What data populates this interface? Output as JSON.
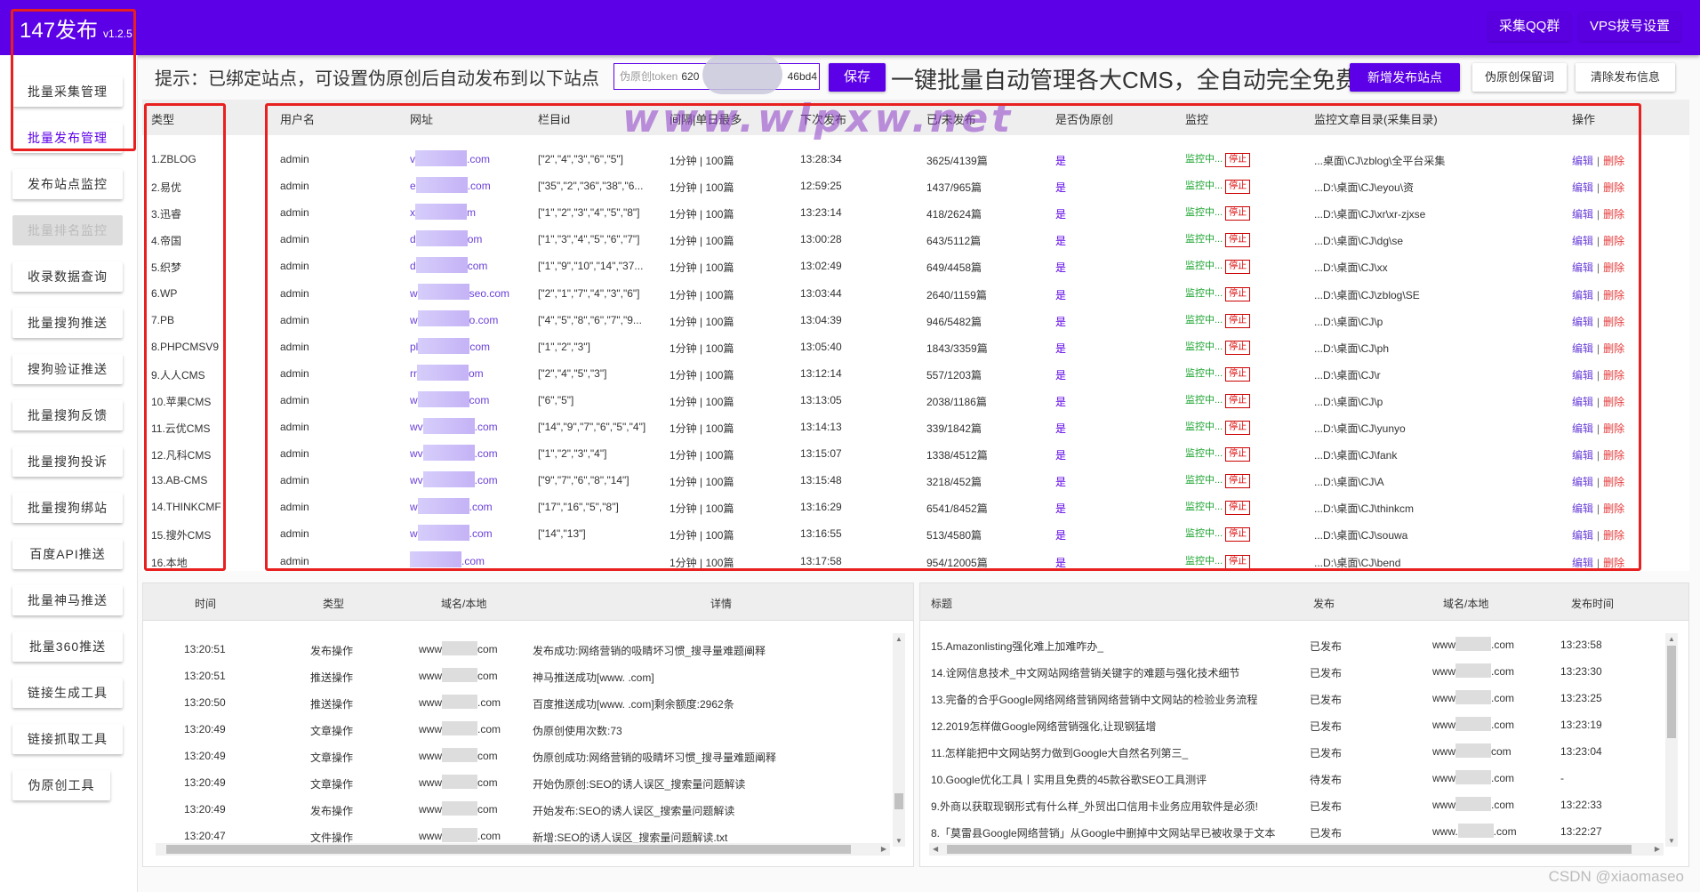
{
  "app": {
    "title": "147发布",
    "version": "v1.2.5"
  },
  "topbar": {
    "qq_group": "采集QQ群",
    "vps_settings": "VPS拨号设置"
  },
  "sidebar": {
    "items": [
      {
        "label": "批量采集管理",
        "state": "normal"
      },
      {
        "label": "批量发布管理",
        "state": "active"
      },
      {
        "label": "发布站点监控",
        "state": "normal"
      },
      {
        "label": "批量排名监控",
        "state": "disabled"
      },
      {
        "label": "收录数据查询",
        "state": "normal"
      },
      {
        "label": "批量搜狗推送",
        "state": "normal"
      },
      {
        "label": "搜狗验证推送",
        "state": "normal"
      },
      {
        "label": "批量搜狗反馈",
        "state": "normal"
      },
      {
        "label": "批量搜狗投诉",
        "state": "normal"
      },
      {
        "label": "批量搜狗绑站",
        "state": "normal"
      },
      {
        "label": "百度API推送",
        "state": "normal"
      },
      {
        "label": "批量神马推送",
        "state": "normal"
      },
      {
        "label": "批量360推送",
        "state": "normal"
      },
      {
        "label": "链接生成工具",
        "state": "normal"
      },
      {
        "label": "链接抓取工具",
        "state": "normal"
      },
      {
        "label": "伪原创工具",
        "state": "normal"
      }
    ]
  },
  "toolbar": {
    "hint": "提示：已绑定站点，可设置伪原创后自动发布到以下站点",
    "token_label": "伪原创token",
    "token_prefix": "620",
    "token_suffix": "46bd4",
    "save": "保存",
    "slogan": "一键批量自动管理各大CMS，全自动完全免费",
    "add_site": "新增发布站点",
    "keep_words": "伪原创保留词",
    "clear_info": "清除发布信息"
  },
  "watermark": "www.wlpxw.net",
  "sites_table": {
    "headers": {
      "type": "类型",
      "username": "用户名",
      "url": "网址",
      "column_id": "栏目id",
      "interval": "间隔|单日最多",
      "next_publish": "下次发布",
      "published": "已/未发布",
      "pseudo": "是否伪原创",
      "monitor": "监控",
      "monitor_dir": "监控文章目录(采集目录)",
      "actions": "操作"
    },
    "monitoring_label": "监控中...",
    "stop_label": "停止",
    "edit_label": "编辑",
    "delete_label": "删除",
    "rows": [
      {
        "type": "1.ZBLOG",
        "username": "admin",
        "url_pre": "v",
        "url_post": ".com",
        "column_id": "[\"2\",\"4\",\"3\",\"6\",\"5\"]",
        "interval": "1分钟 | 100篇",
        "next": "13:28:34",
        "published": "3625/4139篇",
        "pseudo": "是",
        "dir": "...桌面\\CJ\\zblog\\全平台采集"
      },
      {
        "type": "2.易优",
        "username": "admin",
        "url_pre": "e",
        "url_post": ".com",
        "column_id": "[\"35\",\"2\",\"36\",\"38\",\"6...",
        "interval": "1分钟 | 100篇",
        "next": "12:59:25",
        "published": "1437/965篇",
        "pseudo": "是",
        "dir": "...D:\\桌面\\CJ\\eyou\\资"
      },
      {
        "type": "3.迅睿",
        "username": "admin",
        "url_pre": "x",
        "url_post": "m",
        "column_id": "[\"1\",\"2\",\"3\",\"4\",\"5\",\"8\"]",
        "interval": "1分钟 | 100篇",
        "next": "13:23:14",
        "published": "418/2624篇",
        "pseudo": "是",
        "dir": "...D:\\桌面\\CJ\\xr\\xr-zjxse"
      },
      {
        "type": "4.帝国",
        "username": "admin",
        "url_pre": "d",
        "url_post": "om",
        "column_id": "[\"1\",\"3\",\"4\",\"5\",\"6\",\"7\"]",
        "interval": "1分钟 | 100篇",
        "next": "13:00:28",
        "published": "643/5112篇",
        "pseudo": "是",
        "dir": "...D:\\桌面\\CJ\\dg\\se"
      },
      {
        "type": "5.织梦",
        "username": "admin",
        "url_pre": "d",
        "url_post": "com",
        "column_id": "[\"1\",\"9\",\"10\",\"14\",\"37...",
        "interval": "1分钟 | 100篇",
        "next": "13:02:49",
        "published": "649/4458篇",
        "pseudo": "是",
        "dir": "...D:\\桌面\\CJ\\xx"
      },
      {
        "type": "6.WP",
        "username": "admin",
        "url_pre": "w",
        "url_post": "seo.com",
        "column_id": "[\"2\",\"1\",\"7\",\"4\",\"3\",\"6\"]",
        "interval": "1分钟 | 100篇",
        "next": "13:03:44",
        "published": "2640/1159篇",
        "pseudo": "是",
        "dir": "...D:\\桌面\\CJ\\zblog\\SE"
      },
      {
        "type": "7.PB",
        "username": "admin",
        "url_pre": "w",
        "url_post": "o.com",
        "column_id": "[\"4\",\"5\",\"8\",\"6\",\"7\",\"9...",
        "interval": "1分钟 | 100篇",
        "next": "13:04:39",
        "published": "946/5482篇",
        "pseudo": "是",
        "dir": "...D:\\桌面\\CJ\\p"
      },
      {
        "type": "8.PHPCMSV9",
        "username": "admin",
        "url_pre": "pl",
        "url_post": "com",
        "column_id": "[\"1\",\"2\",\"3\"]",
        "interval": "1分钟 | 100篇",
        "next": "13:05:40",
        "published": "1843/3359篇",
        "pseudo": "是",
        "dir": "...D:\\桌面\\CJ\\ph"
      },
      {
        "type": "9.人人CMS",
        "username": "admin",
        "url_pre": "rr",
        "url_post": "om",
        "column_id": "[\"2\",\"4\",\"5\",\"3\"]",
        "interval": "1分钟 | 100篇",
        "next": "13:12:14",
        "published": "557/1203篇",
        "pseudo": "是",
        "dir": "...D:\\桌面\\CJ\\r"
      },
      {
        "type": "10.苹果CMS",
        "username": "admin",
        "url_pre": "w",
        "url_post": "com",
        "column_id": "[\"6\",\"5\"]",
        "interval": "1分钟 | 100篇",
        "next": "13:13:05",
        "published": "2038/1186篇",
        "pseudo": "是",
        "dir": "...D:\\桌面\\CJ\\p"
      },
      {
        "type": "11.云优CMS",
        "username": "admin",
        "url_pre": "wv",
        "url_post": ".com",
        "column_id": "[\"14\",\"9\",\"7\",\"6\",\"5\",\"4\"]",
        "interval": "1分钟 | 100篇",
        "next": "13:14:13",
        "published": "339/1842篇",
        "pseudo": "是",
        "dir": "...D:\\桌面\\CJ\\yunyo"
      },
      {
        "type": "12.凡科CMS",
        "username": "admin",
        "url_pre": "wv",
        "url_post": ".com",
        "column_id": "[\"1\",\"2\",\"3\",\"4\"]",
        "interval": "1分钟 | 100篇",
        "next": "13:15:07",
        "published": "1338/4512篇",
        "pseudo": "是",
        "dir": "...D:\\桌面\\CJ\\fank"
      },
      {
        "type": "13.AB-CMS",
        "username": "admin",
        "url_pre": "wv",
        "url_post": ".com",
        "column_id": "[\"9\",\"7\",\"6\",\"8\",\"14\"]",
        "interval": "1分钟 | 100篇",
        "next": "13:15:48",
        "published": "3218/452篇",
        "pseudo": "是",
        "dir": "...D:\\桌面\\CJ\\A"
      },
      {
        "type": "14.THINKCMF",
        "username": "admin",
        "url_pre": "w",
        "url_post": ".com",
        "column_id": "[\"17\",\"16\",\"5\",\"8\"]",
        "interval": "1分钟 | 100篇",
        "next": "13:16:29",
        "published": "6541/8452篇",
        "pseudo": "是",
        "dir": "...D:\\桌面\\CJ\\thinkcm"
      },
      {
        "type": "15.搜外CMS",
        "username": "admin",
        "url_pre": "w",
        "url_post": ".com",
        "column_id": "[\"14\",\"13\"]",
        "interval": "1分钟 | 100篇",
        "next": "13:16:55",
        "published": "513/4580篇",
        "pseudo": "是",
        "dir": "...D:\\桌面\\CJ\\souwa"
      },
      {
        "type": "16.本地",
        "username": "admin",
        "url_pre": "",
        "url_post": ".com",
        "column_id": "",
        "interval": "1分钟 | 100篇",
        "next": "13:17:58",
        "published": "954/12005篇",
        "pseudo": "是",
        "dir": "...D:\\桌面\\CJ\\bend"
      }
    ]
  },
  "op_log": {
    "headers": {
      "time": "时间",
      "type": "类型",
      "domain": "域名/本地",
      "detail": "详情"
    },
    "rows": [
      {
        "time": "13:20:51",
        "type": "发布操作",
        "domain_pre": "www",
        "domain_post": "com",
        "detail": "发布成功:网络营销的吸睛坏习惯_搜寻量难题阐释"
      },
      {
        "time": "13:20:51",
        "type": "推送操作",
        "domain_pre": "www",
        "domain_post": "com",
        "detail": "神马推送成功[www.        .com]"
      },
      {
        "time": "13:20:50",
        "type": "推送操作",
        "domain_pre": "www",
        "domain_post": ".com",
        "detail": "百度推送成功[www.        .com]剩余额度:2962条"
      },
      {
        "time": "13:20:49",
        "type": "文章操作",
        "domain_pre": "www",
        "domain_post": ".com",
        "detail": "伪原创使用次数:73"
      },
      {
        "time": "13:20:49",
        "type": "文章操作",
        "domain_pre": "www",
        "domain_post": "com",
        "detail": "伪原创成功:网络营销的吸睛坏习惯_搜寻量难题阐释"
      },
      {
        "time": "13:20:49",
        "type": "文章操作",
        "domain_pre": "www",
        "domain_post": "com",
        "detail": "开始伪原创:SEO的诱人误区_搜索量问题解读"
      },
      {
        "time": "13:20:49",
        "type": "发布操作",
        "domain_pre": "www",
        "domain_post": "com",
        "detail": "开始发布:SEO的诱人误区_搜索量问题解读"
      },
      {
        "time": "13:20:47",
        "type": "文件操作",
        "domain_pre": "www",
        "domain_post": ".com",
        "detail": "新增:SEO的诱人误区_搜索量问题解读.txt"
      }
    ]
  },
  "publish_log": {
    "headers": {
      "title": "标题",
      "status": "发布",
      "domain": "域名/本地",
      "time": "发布时间"
    },
    "rows": [
      {
        "title": "15.Amazonlisting强化难上加难咋办_",
        "status": "已发布",
        "domain_pre": "www",
        "domain_post": ".com",
        "time": "13:23:58"
      },
      {
        "title": "14.诠网信息技术_中文网站网络营销关键字的难题与强化技术细节",
        "status": "已发布",
        "domain_pre": "www",
        "domain_post": ".com",
        "time": "13:23:30"
      },
      {
        "title": "13.完备的合乎Google网络网络营销网络营销中文网站的检验业务流程",
        "status": "已发布",
        "domain_pre": "www",
        "domain_post": ".com",
        "time": "13:23:25"
      },
      {
        "title": "12.2019怎样做Google网络营销强化,让现钢猛增",
        "status": "已发布",
        "domain_pre": "www",
        "domain_post": ".com",
        "time": "13:23:19"
      },
      {
        "title": "11.怎样能把中文网站努力做到Google大自然名列第三_",
        "status": "已发布",
        "domain_pre": "www",
        "domain_post": "com",
        "time": "13:23:04"
      },
      {
        "title": "10.Google优化工具丨实用且免费的45款谷歌SEO工具测评",
        "status": "待发布",
        "domain_pre": "www",
        "domain_post": ".com",
        "time": "-"
      },
      {
        "title": "9.外商以获取现钢形式有什么样_外贸出口信用卡业务应用软件是必须!",
        "status": "已发布",
        "domain_pre": "www",
        "domain_post": ".com",
        "time": "13:22:33"
      },
      {
        "title": "8.「莫雷县Google网络营销」从Google中删掉中文网站早已被收录于文本",
        "status": "已发布",
        "domain_pre": "www.",
        "domain_post": ".com",
        "time": "13:22:27"
      }
    ]
  },
  "footer": {
    "credit": "CSDN @xiaomaseo"
  },
  "colors": {
    "brand": "#5c00e8",
    "monitor": "#1aa32e",
    "danger": "#e43a3a",
    "highlight": "#e82020"
  }
}
